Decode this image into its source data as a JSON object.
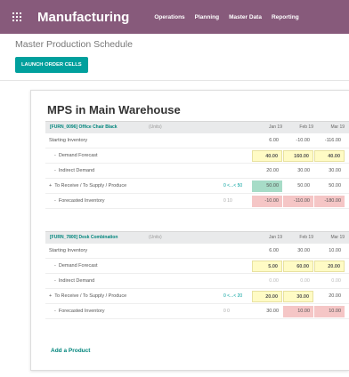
{
  "topbar": {
    "app_title": "Manufacturing",
    "menu": [
      "Operations",
      "Planning",
      "Master Data",
      "Reporting"
    ]
  },
  "breadcrumb": "Master Production Schedule",
  "launch_button": "LAUNCH ORDER CELLS",
  "mps": {
    "title": "MPS in Main Warehouse",
    "add_product": "Add a Product",
    "columns": [
      "Jan 19",
      "Feb 19",
      "Mar 19"
    ],
    "products": [
      {
        "name": "[FURN_0096] Office Chair Black",
        "unit": "(Units)",
        "rows": [
          {
            "label": "Starting Inventory",
            "style": "plain",
            "rule": "",
            "cells": [
              {
                "v": "6.00",
                "s": ""
              },
              {
                "v": "-10.00",
                "s": ""
              },
              {
                "v": "-116.00",
                "s": ""
              }
            ]
          },
          {
            "label": "Demand Forecast",
            "style": "sub",
            "rule": "",
            "cells": [
              {
                "v": "40.00",
                "s": "yellow"
              },
              {
                "v": "160.00",
                "s": "yellow"
              },
              {
                "v": "40.00",
                "s": "yellow"
              }
            ]
          },
          {
            "label": "Indirect Demand",
            "style": "sub",
            "rule": "",
            "cells": [
              {
                "v": "20.00",
                "s": ""
              },
              {
                "v": "30.00",
                "s": ""
              },
              {
                "v": "30.00",
                "s": ""
              }
            ]
          },
          {
            "label": "To Receive / To Supply / Produce",
            "style": "plus",
            "rule": "0 <...< 50",
            "cells": [
              {
                "v": "50.00",
                "s": "green"
              },
              {
                "v": "50.00",
                "s": ""
              },
              {
                "v": "50.00",
                "s": ""
              }
            ]
          },
          {
            "label": "Forecasted Inventory",
            "style": "sub",
            "rule": "0 10",
            "cells": [
              {
                "v": "-10.00",
                "s": "red"
              },
              {
                "v": "-110.00",
                "s": "red"
              },
              {
                "v": "-180.00",
                "s": "red"
              }
            ]
          }
        ]
      },
      {
        "name": "[FURN_7800] Desk Combination",
        "unit": "(Units)",
        "rows": [
          {
            "label": "Starting Inventory",
            "style": "plain",
            "rule": "",
            "cells": [
              {
                "v": "6.00",
                "s": ""
              },
              {
                "v": "30.00",
                "s": ""
              },
              {
                "v": "10.00",
                "s": ""
              }
            ]
          },
          {
            "label": "Demand Forecast",
            "style": "sub",
            "rule": "",
            "cells": [
              {
                "v": "5.00",
                "s": "yellow"
              },
              {
                "v": "60.00",
                "s": "yellow"
              },
              {
                "v": "20.00",
                "s": "yellow"
              }
            ]
          },
          {
            "label": "Indirect Demand",
            "style": "sub",
            "rule": "",
            "cells": [
              {
                "v": "0.00",
                "s": "faint"
              },
              {
                "v": "0.00",
                "s": "faint"
              },
              {
                "v": "0.00",
                "s": "faint"
              }
            ]
          },
          {
            "label": "To Receive / To Supply / Produce",
            "style": "plus",
            "rule": "0 <...< 20",
            "cells": [
              {
                "v": "20.00",
                "s": "yellow"
              },
              {
                "v": "30.00",
                "s": "yellow"
              },
              {
                "v": "20.00",
                "s": ""
              }
            ]
          },
          {
            "label": "Forecasted Inventory",
            "style": "sub",
            "rule": "0 0",
            "cells": [
              {
                "v": "30.00",
                "s": ""
              },
              {
                "v": "10.00",
                "s": "red"
              },
              {
                "v": "10.00",
                "s": "red"
              }
            ]
          }
        ]
      }
    ]
  }
}
